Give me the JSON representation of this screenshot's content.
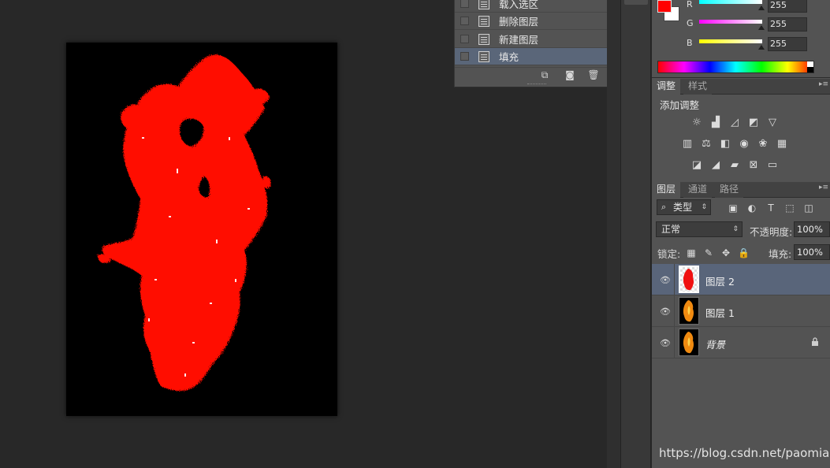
{
  "history": {
    "items": [
      {
        "label": "载入选区",
        "selected": false
      },
      {
        "label": "删除图层",
        "selected": false
      },
      {
        "label": "新建图层",
        "selected": false
      },
      {
        "label": "填充",
        "selected": true
      }
    ],
    "buttons": [
      "new-document-from-state-icon",
      "snapshot-icon",
      "trash-icon"
    ]
  },
  "color": {
    "foreground": "#ff0000",
    "background": "#ffffff",
    "channels": [
      {
        "label": "R",
        "value": "255",
        "gradient": "#00ffff"
      },
      {
        "label": "G",
        "value": "255",
        "gradient": "#ff00ff"
      },
      {
        "label": "B",
        "value": "255",
        "gradient": "#ffff00"
      }
    ]
  },
  "adjustments": {
    "tabs": [
      "调整",
      "样式"
    ],
    "title": "添加调整"
  },
  "layers": {
    "tabs": [
      "图层",
      "通道",
      "路径"
    ],
    "filter_label": "类型",
    "blend_mode": "正常",
    "opacity_label": "不透明度:",
    "opacity_value": "100%",
    "lock_label": "锁定:",
    "fill_label": "填充:",
    "fill_value": "100%",
    "items": [
      {
        "name": "图层 2",
        "selected": true,
        "italic": false,
        "locked": false
      },
      {
        "name": "图层 1",
        "selected": false,
        "italic": false,
        "locked": false
      },
      {
        "name": "背景",
        "selected": false,
        "italic": true,
        "locked": true
      }
    ]
  },
  "watermark": "https://blog.csdn.net/paomiao",
  "accent_colors": {
    "selection": "#5a6679",
    "flame": "#ff0000"
  }
}
